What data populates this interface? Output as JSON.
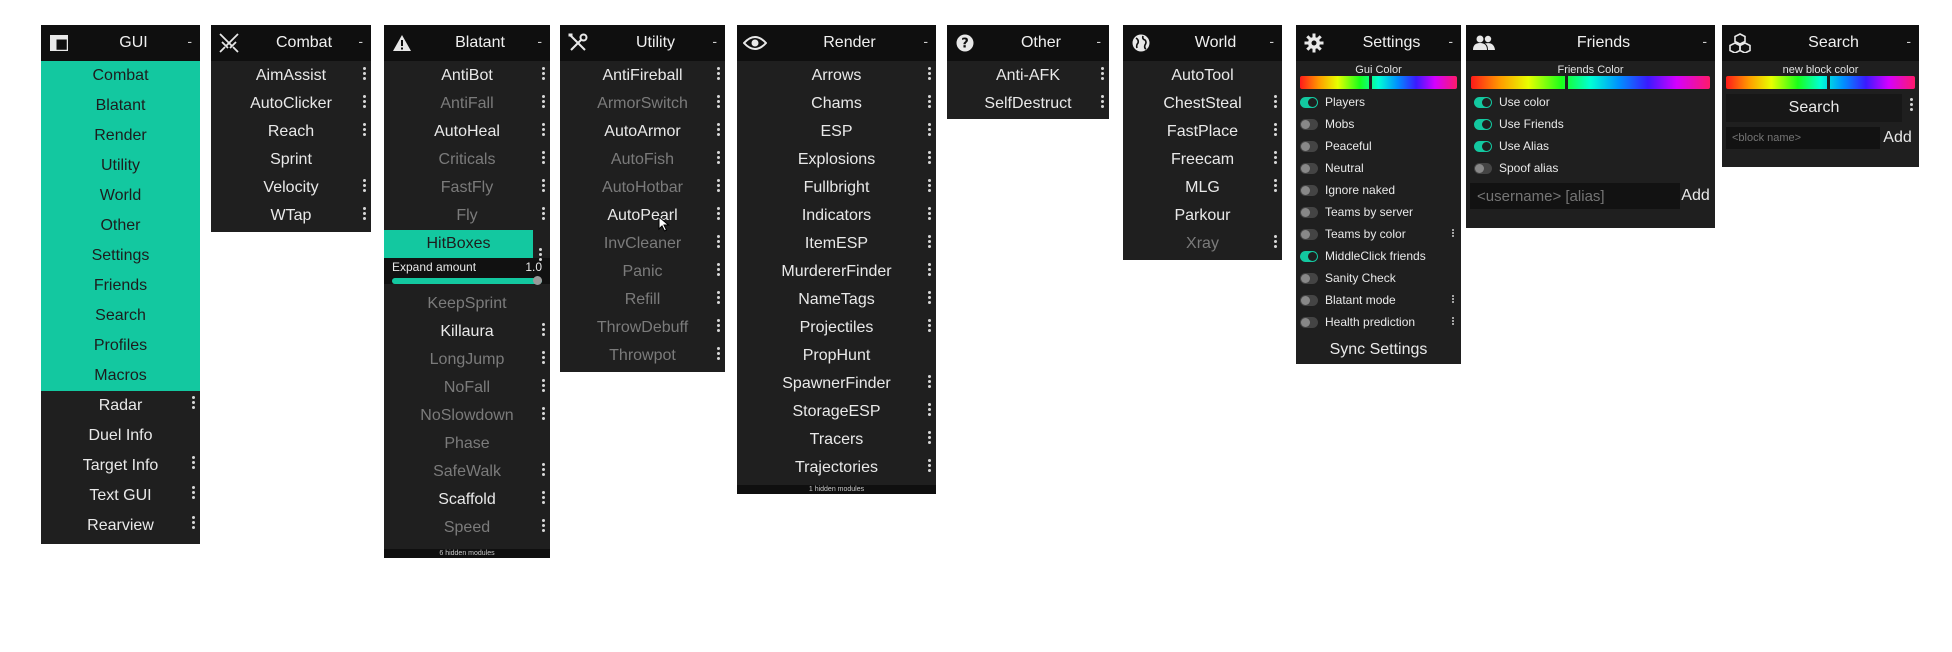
{
  "colors": {
    "accent": "#13c8a0",
    "panel": "#1f1f1f",
    "header": "#0f0f0f",
    "disabled": "#7b7b7b"
  },
  "gui": {
    "title": "GUI",
    "icon": "layout-icon",
    "minimize": "-",
    "categories": [
      "Combat",
      "Blatant",
      "Render",
      "Utility",
      "World",
      "Other",
      "Settings",
      "Friends",
      "Search",
      "Profiles",
      "Macros"
    ],
    "modules": [
      {
        "label": "Radar",
        "options": true
      },
      {
        "label": "Duel Info",
        "options": false
      },
      {
        "label": "Target Info",
        "options": true
      },
      {
        "label": "Text GUI",
        "options": true
      },
      {
        "label": "Rearview",
        "options": true
      }
    ]
  },
  "combat": {
    "title": "Combat",
    "icon": "swords-icon",
    "minimize": "-",
    "modules": [
      {
        "label": "AimAssist",
        "enabled": true,
        "options": true
      },
      {
        "label": "AutoClicker",
        "enabled": true,
        "options": true
      },
      {
        "label": "Reach",
        "enabled": true,
        "options": true
      },
      {
        "label": "Sprint",
        "enabled": true,
        "options": false
      },
      {
        "label": "Velocity",
        "enabled": true,
        "options": true
      },
      {
        "label": "WTap",
        "enabled": true,
        "options": true
      }
    ]
  },
  "blatant": {
    "title": "Blatant",
    "icon": "warning-icon",
    "minimize": "-",
    "modules_top": [
      {
        "label": "AntiBot",
        "enabled": true,
        "options": true
      },
      {
        "label": "AntiFall",
        "enabled": false,
        "options": true
      },
      {
        "label": "AutoHeal",
        "enabled": true,
        "options": true
      },
      {
        "label": "Criticals",
        "enabled": false,
        "options": true
      },
      {
        "label": "FastFly",
        "enabled": false,
        "options": true
      },
      {
        "label": "Fly",
        "enabled": false,
        "options": true
      }
    ],
    "selected": {
      "label": "HitBoxes",
      "options": true
    },
    "setting": {
      "label": "Expand amount",
      "value": "1.0",
      "fraction": 1.0
    },
    "modules_bottom": [
      {
        "label": "KeepSprint",
        "enabled": false,
        "options": false
      },
      {
        "label": "Killaura",
        "enabled": true,
        "options": true
      },
      {
        "label": "LongJump",
        "enabled": false,
        "options": true
      },
      {
        "label": "NoFall",
        "enabled": false,
        "options": true
      },
      {
        "label": "NoSlowdown",
        "enabled": false,
        "options": true
      },
      {
        "label": "Phase",
        "enabled": false,
        "options": false
      },
      {
        "label": "SafeWalk",
        "enabled": false,
        "options": true
      },
      {
        "label": "Scaffold",
        "enabled": true,
        "options": true
      },
      {
        "label": "Speed",
        "enabled": false,
        "options": true
      }
    ],
    "footer": "6 hidden modules"
  },
  "utility": {
    "title": "Utility",
    "icon": "wrench-icon",
    "minimize": "-",
    "modules": [
      {
        "label": "AntiFireball",
        "enabled": true,
        "options": true
      },
      {
        "label": "ArmorSwitch",
        "enabled": false,
        "options": true
      },
      {
        "label": "AutoArmor",
        "enabled": true,
        "options": true
      },
      {
        "label": "AutoFish",
        "enabled": false,
        "options": true
      },
      {
        "label": "AutoHotbar",
        "enabled": false,
        "options": true
      },
      {
        "label": "AutoPearl",
        "enabled": true,
        "options": true
      },
      {
        "label": "InvCleaner",
        "enabled": false,
        "options": true
      },
      {
        "label": "Panic",
        "enabled": false,
        "options": true
      },
      {
        "label": "Refill",
        "enabled": false,
        "options": true
      },
      {
        "label": "ThrowDebuff",
        "enabled": false,
        "options": true
      },
      {
        "label": "Throwpot",
        "enabled": false,
        "options": true
      }
    ]
  },
  "render": {
    "title": "Render",
    "icon": "eye-icon",
    "minimize": "-",
    "modules": [
      {
        "label": "Arrows",
        "enabled": true,
        "options": true
      },
      {
        "label": "Chams",
        "enabled": true,
        "options": true
      },
      {
        "label": "ESP",
        "enabled": true,
        "options": true
      },
      {
        "label": "Explosions",
        "enabled": true,
        "options": true
      },
      {
        "label": "Fullbright",
        "enabled": true,
        "options": true
      },
      {
        "label": "Indicators",
        "enabled": true,
        "options": true
      },
      {
        "label": "ItemESP",
        "enabled": true,
        "options": true
      },
      {
        "label": "MurdererFinder",
        "enabled": true,
        "options": true
      },
      {
        "label": "NameTags",
        "enabled": true,
        "options": true
      },
      {
        "label": "Projectiles",
        "enabled": true,
        "options": true
      },
      {
        "label": "PropHunt",
        "enabled": true,
        "options": false
      },
      {
        "label": "SpawnerFinder",
        "enabled": true,
        "options": true
      },
      {
        "label": "StorageESP",
        "enabled": true,
        "options": true
      },
      {
        "label": "Tracers",
        "enabled": true,
        "options": true
      },
      {
        "label": "Trajectories",
        "enabled": true,
        "options": true
      }
    ],
    "footer": "1 hidden modules"
  },
  "other": {
    "title": "Other",
    "icon": "question-icon",
    "minimize": "-",
    "modules": [
      {
        "label": "Anti-AFK",
        "enabled": true,
        "options": true
      },
      {
        "label": "SelfDestruct",
        "enabled": true,
        "options": true
      }
    ]
  },
  "world": {
    "title": "World",
    "icon": "globe-icon",
    "minimize": "-",
    "modules": [
      {
        "label": "AutoTool",
        "enabled": true,
        "options": false
      },
      {
        "label": "ChestSteal",
        "enabled": true,
        "options": true
      },
      {
        "label": "FastPlace",
        "enabled": true,
        "options": true
      },
      {
        "label": "Freecam",
        "enabled": true,
        "options": true
      },
      {
        "label": "MLG",
        "enabled": true,
        "options": true
      },
      {
        "label": "Parkour",
        "enabled": true,
        "options": false
      },
      {
        "label": "Xray",
        "enabled": false,
        "options": true
      }
    ]
  },
  "settings": {
    "title": "Settings",
    "icon": "gear-icon",
    "minimize": "-",
    "color_label": "Gui Color",
    "toggles": [
      {
        "label": "Players",
        "on": true,
        "options": false
      },
      {
        "label": "Mobs",
        "on": false,
        "options": false
      },
      {
        "label": "Peaceful",
        "on": false,
        "options": false
      },
      {
        "label": "Neutral",
        "on": false,
        "options": false
      },
      {
        "label": "Ignore naked",
        "on": false,
        "options": false
      },
      {
        "label": "Teams by server",
        "on": false,
        "options": false
      },
      {
        "label": "Teams by color",
        "on": false,
        "options": true
      },
      {
        "label": "MiddleClick friends",
        "on": true,
        "options": false
      },
      {
        "label": "Sanity Check",
        "on": false,
        "options": false
      },
      {
        "label": "Blatant mode",
        "on": false,
        "options": true
      },
      {
        "label": "Health prediction",
        "on": false,
        "options": true
      }
    ],
    "sync_label": "Sync Settings"
  },
  "friends": {
    "title": "Friends",
    "icon": "users-icon",
    "minimize": "-",
    "color_label": "Friends Color",
    "toggles": [
      {
        "label": "Use color",
        "on": true
      },
      {
        "label": "Use Friends",
        "on": true
      },
      {
        "label": "Use Alias",
        "on": true
      },
      {
        "label": "Spoof alias",
        "on": false
      }
    ],
    "input_placeholder": "<username> [alias]",
    "add_label": "Add"
  },
  "search": {
    "title": "Search",
    "icon": "cubes-icon",
    "minimize": "-",
    "color_label": "new block color",
    "search_label": "Search",
    "input_placeholder": "<block name>",
    "add_label": "Add"
  }
}
